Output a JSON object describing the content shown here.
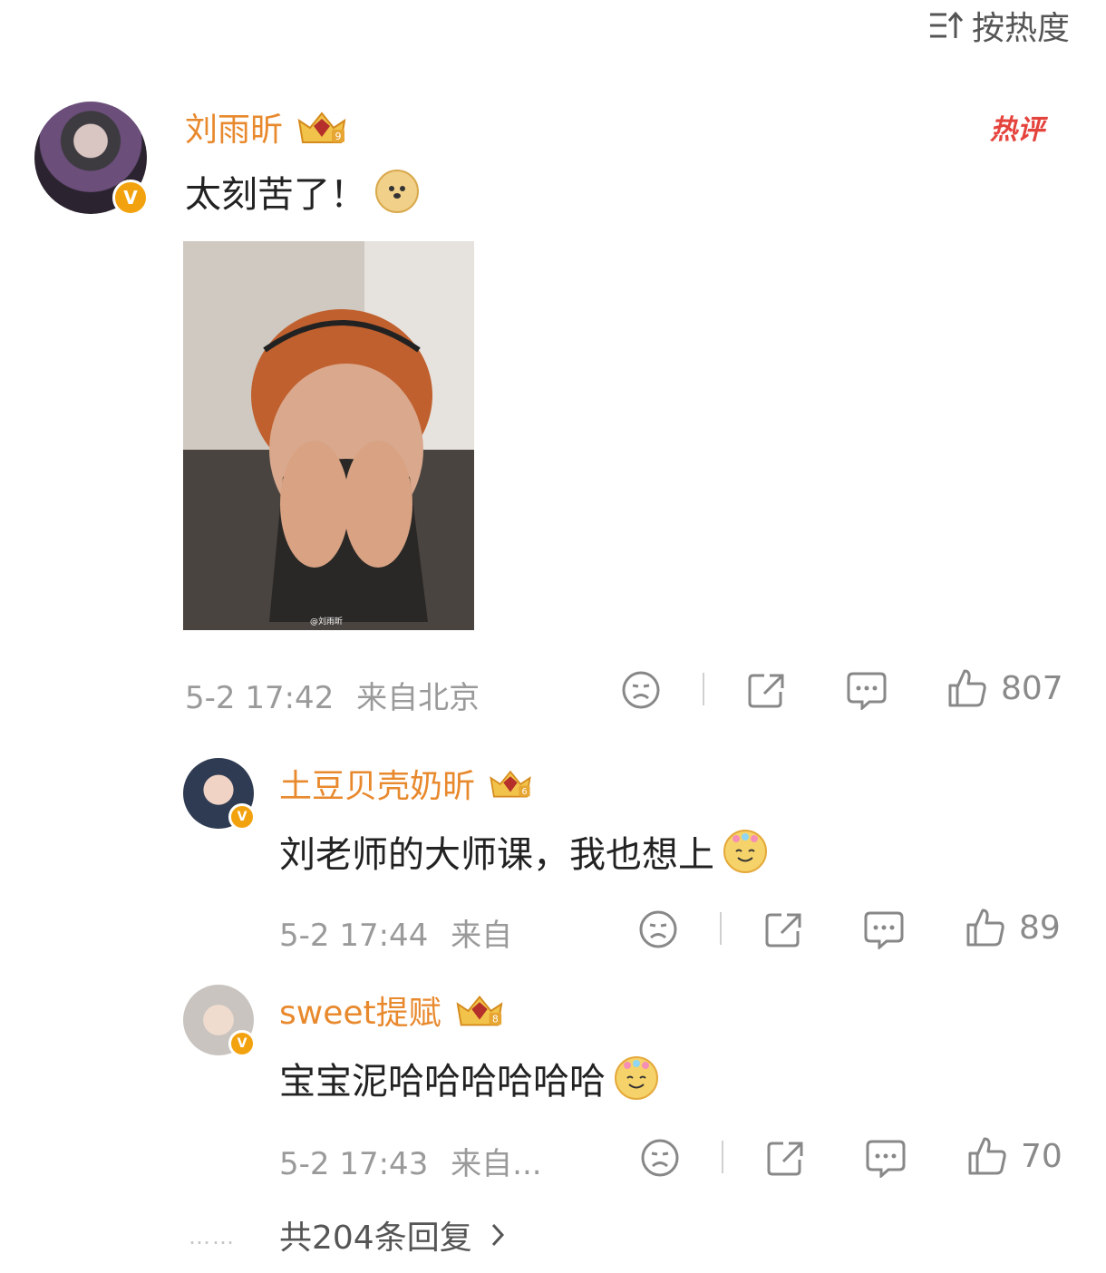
{
  "sort": {
    "label": "按热度"
  },
  "main_comment": {
    "username": "刘雨昕",
    "crown_level": "9",
    "text": "太刻苦了！",
    "emoji": "doge-emoji",
    "hot_label": "热评",
    "image_watermark": "@刘雨昕",
    "timestamp": "5-2 17:42",
    "location": "来自北京",
    "likes": "807"
  },
  "replies": [
    {
      "username": "土豆贝壳奶昕",
      "crown_level": "6",
      "text": "刘老师的大师课，我也想上",
      "emoji": "flower-smile-emoji",
      "timestamp": "5-2 17:44",
      "location": "来自",
      "likes": "89"
    },
    {
      "username": "sweet提赋",
      "crown_level": "8",
      "text": "宝宝泥哈哈哈哈哈哈",
      "emoji": "flower-smile-emoji",
      "timestamp": "5-2 17:43",
      "location": "来自...",
      "likes": "70"
    }
  ],
  "more_replies": {
    "label": "共204条回复",
    "dots": "……"
  },
  "colors": {
    "username": "#e8892d",
    "meta": "#9a9a9a",
    "hot": "#e5443d",
    "badge": "#f3a20f"
  }
}
